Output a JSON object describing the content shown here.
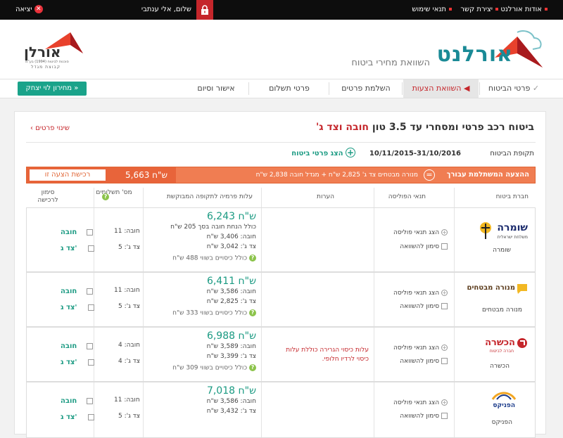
{
  "topbar": {
    "about": "אודות אורלנט",
    "contact": "יצירת קשר",
    "terms": "תנאי שימוש",
    "greeting": "שלום, אלי ענתבי",
    "logout": "יציאה"
  },
  "header": {
    "brand": "אורלנט",
    "tagline": "השוואת מחירי ביטוח",
    "partner_name": "אורלן",
    "partner_sub1": "סוכנות לביטוח (1994) בע\"מ",
    "partner_sub2": "קבוצת מגדל"
  },
  "steps": {
    "details": "פרטי הביטוח",
    "compare": "השוואת הצעות",
    "complete": "השלמת פרטים",
    "payment": "פרטי תשלום",
    "confirm": "אישור וסיום"
  },
  "back_button": "מחירון לוי יצחק »",
  "card": {
    "title_main": "ביטוח רכב פרטי ומסחרי עד 3.5 טון",
    "title_red": "חובה וצד ג'",
    "change_details": "שינוי פרטים",
    "period_label": "תקופת הביטוח",
    "period_value": "10/11/2015-31/10/2016",
    "show_details": "הצג פרטי ביטוח"
  },
  "banner": {
    "label": "ההצעה המשתלמת עבורך",
    "description": "מנורה מבטחים צד ג' 2,825 ש\"ח + מגדל חובה 2,838 ש\"ח",
    "price": "5,663 ש\"ח",
    "buy": "רכישת הצעה זו"
  },
  "columns": {
    "company": "חברת ביטוח",
    "policy": "תנאי הפוליסה",
    "notes": "הערות",
    "cost": "עלות פרמיה לתקופה המבוקשת",
    "payments": "מס' תשלומים",
    "select": "סימון לרכישה"
  },
  "labels": {
    "show_policy": "הצג תנאי פוליסה",
    "compare": "סימון להשוואה",
    "mandatory": "חובה",
    "third_party": "צד ג'"
  },
  "rows": [
    {
      "company": "שומרה",
      "logo_text": "שומרה",
      "logo_sub": "משלחת ישראלית",
      "price": "6,243 ש\"ח",
      "extra": "כולל הנחת חובה בסך 205 ש\"ח",
      "mandatory": "חובה: 3,406 ש\"ח",
      "third": "צד ג': 3,042 ש\"ח",
      "coverage": "כולל כיסויים בשווי 488 ש\"ח",
      "notes": "",
      "pay_m": "חובה: 11",
      "pay_t": "צד ג': 5"
    },
    {
      "company": "מנורה מבטחים",
      "logo_text": "מנורה מבטחים",
      "logo_sub": "",
      "price": "6,411 ש\"ח",
      "extra": "",
      "mandatory": "חובה: 3,586 ש\"ח",
      "third": "צד ג': 2,825 ש\"ח",
      "coverage": "כולל כיסויים בשווי 333 ש\"ח",
      "notes": "",
      "pay_m": "חובה: 11",
      "pay_t": "צד ג': 5"
    },
    {
      "company": "הכשרה",
      "logo_text": "הכשרה",
      "logo_sub": "חברה לביטוח",
      "price": "6,988 ש\"ח",
      "extra": "",
      "mandatory": "חובה: 3,589 ש\"ח",
      "third": "צד ג': 3,399 ש\"ח",
      "coverage": "כולל כיסויים בשווי 309 ש\"ח",
      "notes": "עלות כיסוי הגרירה כוללת עלות כיסוי לרדיו חלופי.",
      "pay_m": "חובה: 4",
      "pay_t": "צד ג': 4"
    },
    {
      "company": "הפניקס",
      "logo_text": "הפניקס",
      "logo_sub": "",
      "price": "7,018 ש\"ח",
      "extra": "",
      "mandatory": "חובה: 3,586 ש\"ח",
      "third": "צד ג': 3,432 ש\"ח",
      "coverage": "",
      "notes": "",
      "pay_m": "חובה: 11",
      "pay_t": "צד ג': 5"
    }
  ],
  "colors": {
    "brand_red": "#c5262b",
    "accent_green": "#1aa38a",
    "banner_orange": "#f07d52"
  }
}
